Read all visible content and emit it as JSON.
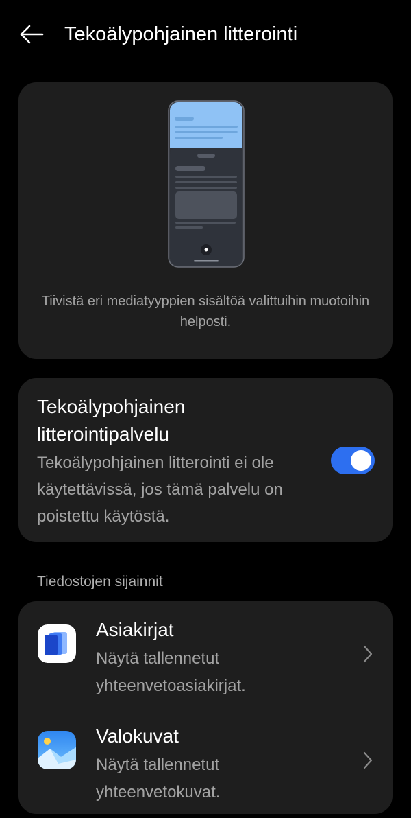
{
  "header": {
    "title": "Tekoälypohjainen litterointi",
    "back_icon": "arrow-left-icon"
  },
  "hero": {
    "description": "Tiivistä eri mediatyyppien sisältöä valittuihin muotoihin helposti."
  },
  "service": {
    "title": "Tekoälypohjainen litterointipalvelu",
    "description": "Tekoälypohjainen litterointi ei ole käytettävissä, jos tämä palvelu on poistettu käytöstä.",
    "enabled": true,
    "toggle_color": "#2d6ff0"
  },
  "file_locations": {
    "label": "Tiedostojen sijainnit",
    "items": [
      {
        "title": "Asiakirjat",
        "subtitle": "Näytä tallennetut yhteenvetoasiakirjat.",
        "icon": "documents-app-icon"
      },
      {
        "title": "Valokuvat",
        "subtitle": "Näytä tallennetut yhteenvetokuvat.",
        "icon": "photos-app-icon"
      }
    ]
  },
  "colors": {
    "background": "#000000",
    "card": "#1e1e1e",
    "secondary_text": "#a3a3a3",
    "accent": "#2d6ff0"
  }
}
